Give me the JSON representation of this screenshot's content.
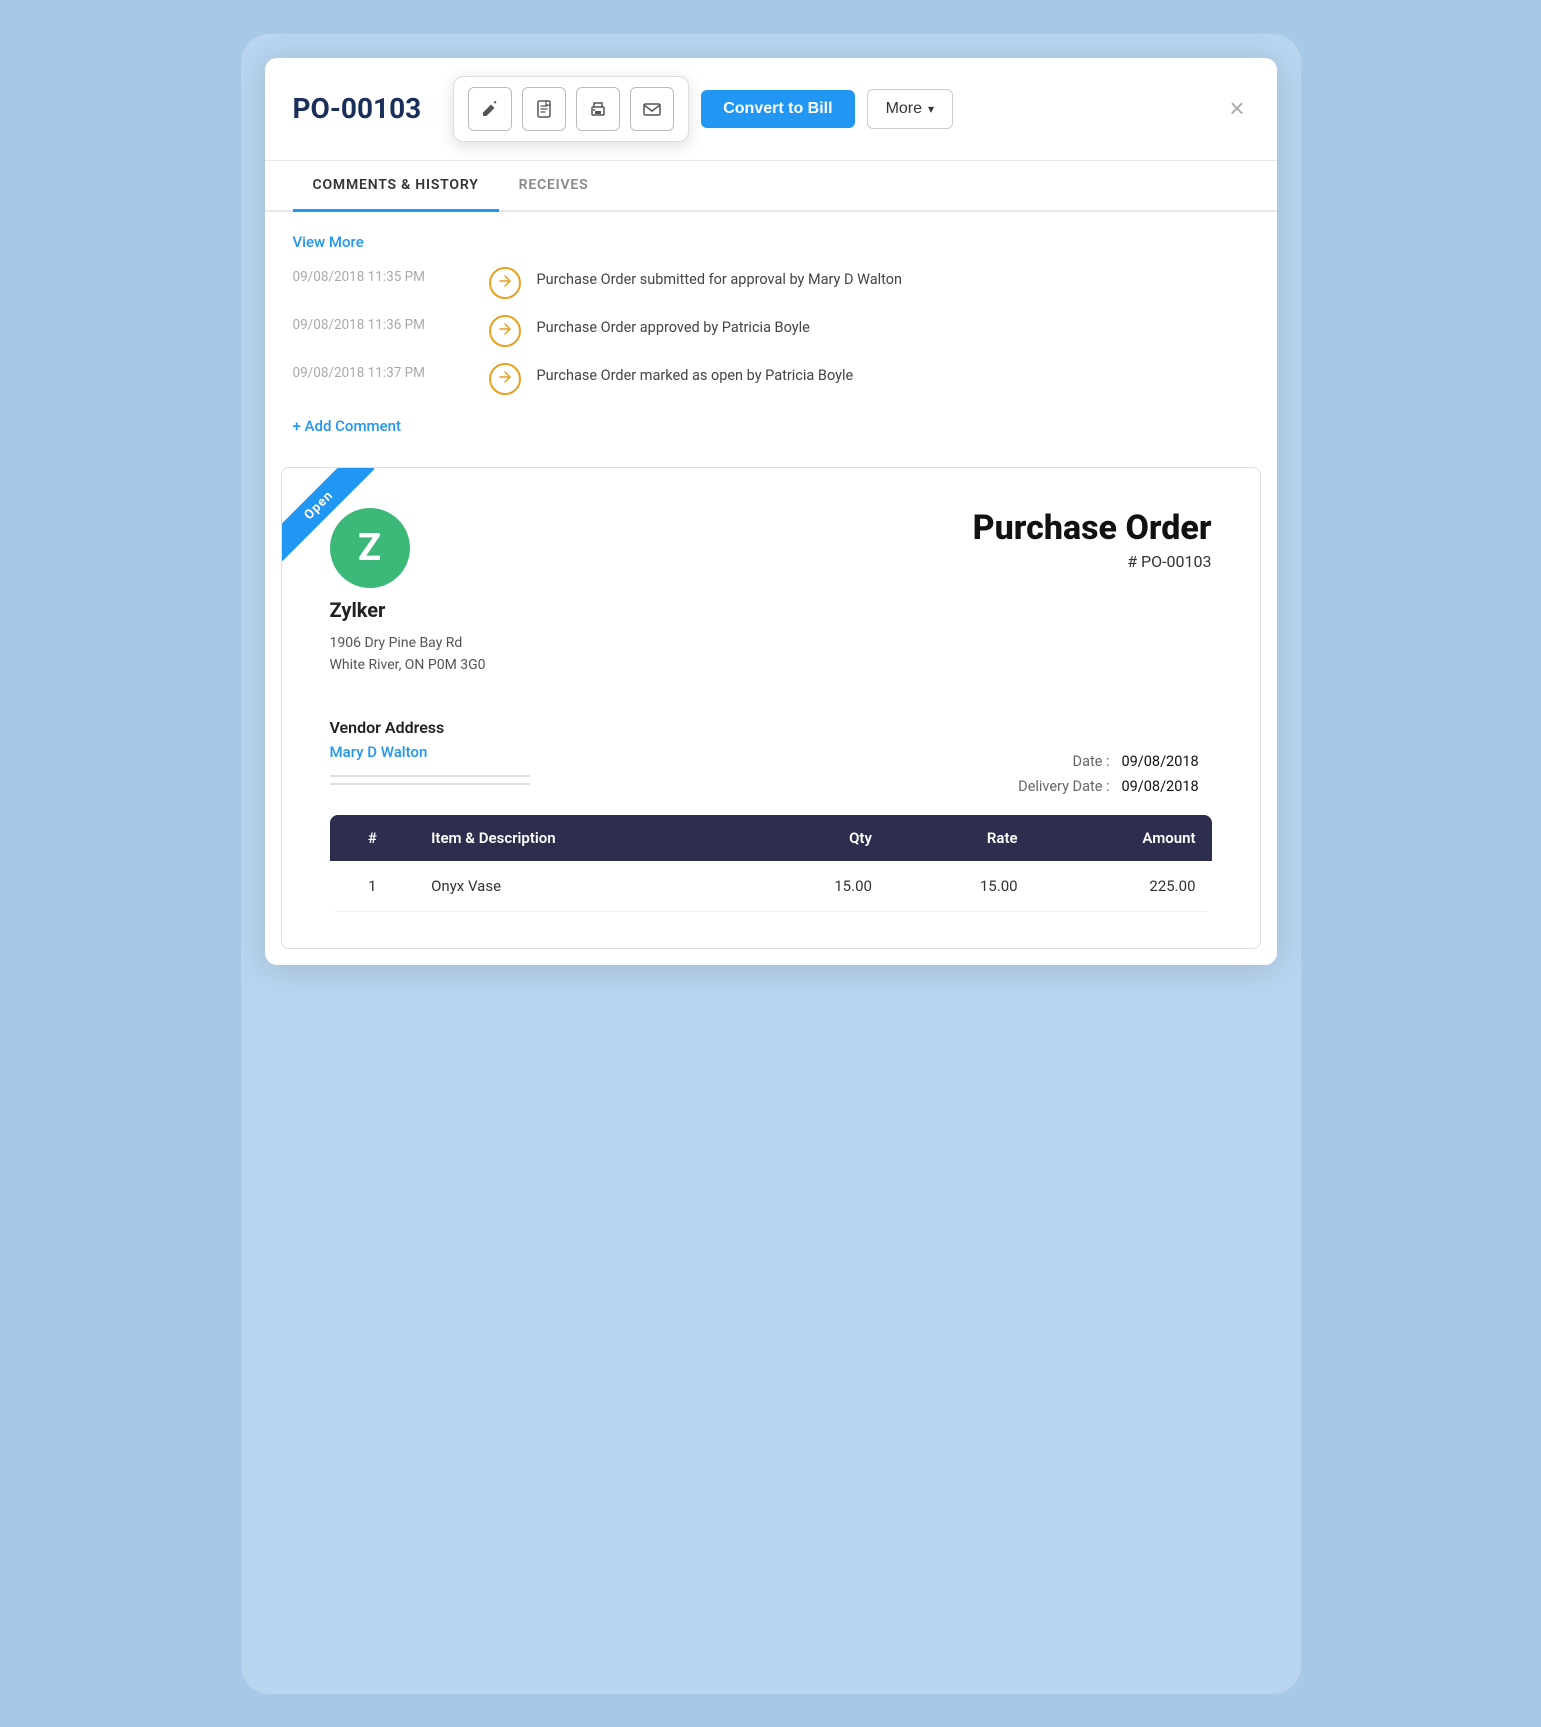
{
  "header": {
    "title": "PO-00103",
    "convert_to_bill_label": "Convert to Bill",
    "more_label": "More",
    "close_label": "×"
  },
  "toolbar": {
    "edit_icon": "✎",
    "pdf_icon": "⬜",
    "print_icon": "🖨",
    "email_icon": "✉"
  },
  "tabs": [
    {
      "id": "comments",
      "label": "COMMENTS & HISTORY",
      "active": true
    },
    {
      "id": "receives",
      "label": "RECEIVES",
      "active": false
    }
  ],
  "comments": {
    "view_more_label": "View More",
    "add_comment_label": "+ Add Comment",
    "history_items": [
      {
        "timestamp": "09/08/2018  11:35 PM",
        "text": "Purchase Order submitted for approval by Mary D Walton"
      },
      {
        "timestamp": "09/08/2018  11:36 PM",
        "text": "Purchase Order approved by Patricia Boyle"
      },
      {
        "timestamp": "09/08/2018  11:37 PM",
        "text": "Purchase Order marked as open by Patricia Boyle"
      }
    ]
  },
  "purchase_order": {
    "ribbon_label": "Open",
    "vendor_initial": "Z",
    "vendor_avatar_color": "#3cb878",
    "vendor_name": "Zylker",
    "vendor_address_line1": "1906 Dry Pine Bay Rd",
    "vendor_address_line2": "White River, ON P0M 3G0",
    "vendor_address_section_label": "Vendor Address",
    "vendor_address_contact": "Mary D Walton",
    "po_title": "Purchase Order",
    "po_number": "# PO-00103",
    "date_label": "Date :",
    "date_value": "09/08/2018",
    "delivery_date_label": "Delivery Date :",
    "delivery_date_value": "09/08/2018",
    "table": {
      "columns": [
        {
          "key": "num",
          "label": "#",
          "align": "center"
        },
        {
          "key": "item",
          "label": "Item & Description",
          "align": "left"
        },
        {
          "key": "qty",
          "label": "Qty",
          "align": "right"
        },
        {
          "key": "rate",
          "label": "Rate",
          "align": "right"
        },
        {
          "key": "amount",
          "label": "Amount",
          "align": "right"
        }
      ],
      "rows": [
        {
          "num": "1",
          "item": "Onyx Vase",
          "qty": "15.00",
          "rate": "15.00",
          "amount": "225.00"
        }
      ]
    }
  }
}
